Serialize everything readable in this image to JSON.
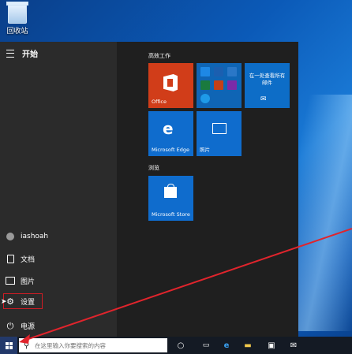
{
  "desktop": {
    "recycle_bin_label": "回收站"
  },
  "start_menu": {
    "header": "开始",
    "nav": [
      {
        "label": "iashoah",
        "icon": "user-avatar-icon"
      },
      {
        "label": "文档",
        "icon": "document-icon"
      },
      {
        "label": "图片",
        "icon": "pictures-icon"
      },
      {
        "label": "设置",
        "icon": "gear-icon"
      },
      {
        "label": "电源",
        "icon": "power-icon"
      }
    ],
    "groups": {
      "work": "高效工作",
      "browse": "浏览"
    },
    "tiles": {
      "office": "Office",
      "mail": "在一处查看所有邮件",
      "edge": "Microsoft Edge",
      "photos": "照片",
      "store": "Microsoft Store"
    }
  },
  "taskbar": {
    "search_placeholder": "在这里输入你要搜索的内容",
    "icons": [
      "task-view-icon",
      "edge-icon",
      "file-explorer-icon",
      "store-icon",
      "mail-icon"
    ]
  },
  "colors": {
    "office": "#d13d19",
    "tile_blue": "#0f6ccd",
    "highlight": "#d01c24"
  }
}
